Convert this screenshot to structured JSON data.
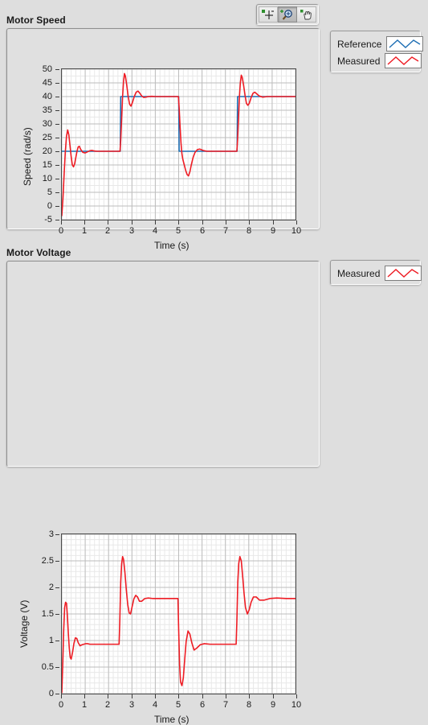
{
  "toolbar": {
    "buttons": [
      {
        "name": "cursor-tool",
        "label": "Cursor movement tool",
        "active": false
      },
      {
        "name": "zoom-tool",
        "label": "Zoom tool",
        "active": true
      },
      {
        "name": "pan-tool",
        "label": "Panning tool",
        "active": false
      }
    ]
  },
  "panels": [
    {
      "title": "Motor Speed",
      "legend": [
        {
          "label": "Reference",
          "color": "#1f6fb4"
        },
        {
          "label": "Measured",
          "color": "#ee1c24"
        }
      ]
    },
    {
      "title": "Motor Voltage",
      "legend": [
        {
          "label": "Measured",
          "color": "#ee1c24"
        }
      ]
    }
  ],
  "chart_data": [
    {
      "type": "line",
      "title": "Motor Speed",
      "xlabel": "Time (s)",
      "ylabel": "Speed (rad/s)",
      "xlim": [
        0,
        10
      ],
      "ylim": [
        -5,
        50
      ],
      "xticks": [
        0,
        1,
        2,
        3,
        4,
        5,
        6,
        7,
        8,
        9,
        10
      ],
      "yticks": [
        -5,
        0,
        5,
        10,
        15,
        20,
        25,
        30,
        35,
        40,
        45,
        50
      ],
      "grid": true,
      "legend_position": "right-outside",
      "series": [
        {
          "name": "Reference",
          "color": "#1f6fb4",
          "x": [
            0,
            0.02,
            2.5,
            2.52,
            5.0,
            5.02,
            7.5,
            7.52,
            10
          ],
          "values": [
            20,
            20,
            20,
            40,
            40,
            20,
            20,
            40,
            40
          ]
        },
        {
          "name": "Measured",
          "color": "#ee1c24",
          "x": [
            0.0,
            0.05,
            0.1,
            0.15,
            0.2,
            0.25,
            0.3,
            0.35,
            0.4,
            0.45,
            0.5,
            0.55,
            0.6,
            0.65,
            0.7,
            0.75,
            0.8,
            0.9,
            1.0,
            1.1,
            1.2,
            1.3,
            1.4,
            1.5,
            1.7,
            2.0,
            2.3,
            2.49,
            2.52,
            2.56,
            2.6,
            2.64,
            2.68,
            2.72,
            2.78,
            2.84,
            2.9,
            2.96,
            3.02,
            3.1,
            3.18,
            3.26,
            3.34,
            3.42,
            3.5,
            3.6,
            3.7,
            3.85,
            4.0,
            4.3,
            4.7,
            4.99,
            5.02,
            5.06,
            5.1,
            5.14,
            5.18,
            5.24,
            5.3,
            5.36,
            5.42,
            5.48,
            5.54,
            5.62,
            5.7,
            5.8,
            5.9,
            6.05,
            6.2,
            6.5,
            7.0,
            7.49,
            7.52,
            7.56,
            7.6,
            7.64,
            7.68,
            7.72,
            7.78,
            7.84,
            7.9,
            7.96,
            8.02,
            8.1,
            8.18,
            8.26,
            8.34,
            8.45,
            8.6,
            8.8,
            9.1,
            9.5,
            10.0
          ],
          "values": [
            -3.5,
            3.0,
            12.0,
            20.0,
            25.5,
            27.8,
            26.0,
            22.0,
            18.0,
            15.0,
            14.3,
            15.5,
            17.8,
            20.0,
            21.6,
            21.8,
            20.8,
            19.6,
            19.4,
            19.8,
            20.2,
            20.3,
            20.1,
            20.0,
            20.0,
            20.0,
            20.0,
            20.0,
            24.0,
            32.0,
            40.0,
            45.5,
            48.4,
            47.5,
            44.0,
            40.0,
            37.2,
            36.5,
            37.8,
            40.0,
            41.6,
            42.0,
            41.2,
            40.2,
            39.7,
            39.8,
            40.0,
            40.1,
            40.0,
            40.0,
            40.0,
            40.0,
            36.0,
            29.0,
            23.0,
            19.0,
            17.0,
            15.0,
            13.0,
            11.5,
            11.0,
            12.5,
            15.0,
            17.8,
            19.6,
            20.6,
            20.8,
            20.3,
            20.0,
            20.0,
            20.0,
            20.0,
            24.0,
            32.0,
            40.0,
            45.0,
            47.8,
            47.0,
            44.0,
            40.5,
            37.5,
            36.8,
            37.5,
            39.6,
            41.2,
            41.6,
            41.0,
            40.2,
            39.8,
            40.0,
            40.0,
            40.0,
            40.0
          ]
        }
      ]
    },
    {
      "type": "line",
      "title": "Motor Voltage",
      "xlabel": "Time (s)",
      "ylabel": "Voltage (V)",
      "xlim": [
        0,
        10
      ],
      "ylim": [
        0,
        3
      ],
      "xticks": [
        0,
        1,
        2,
        3,
        4,
        5,
        6,
        7,
        8,
        9,
        10
      ],
      "yticks": [
        0,
        0.5,
        1,
        1.5,
        2,
        2.5,
        3
      ],
      "grid": true,
      "legend_position": "right-outside",
      "series": [
        {
          "name": "Measured",
          "color": "#ee1c24",
          "x": [
            0.0,
            0.04,
            0.08,
            0.12,
            0.16,
            0.2,
            0.24,
            0.28,
            0.32,
            0.36,
            0.4,
            0.46,
            0.52,
            0.58,
            0.64,
            0.7,
            0.78,
            0.86,
            0.94,
            1.02,
            1.1,
            1.2,
            1.3,
            1.45,
            1.6,
            1.8,
            2.1,
            2.45,
            2.48,
            2.52,
            2.56,
            2.6,
            2.64,
            2.7,
            2.76,
            2.82,
            2.88,
            2.94,
            3.0,
            3.08,
            3.16,
            3.24,
            3.32,
            3.42,
            3.55,
            3.7,
            3.9,
            4.2,
            4.6,
            4.97,
            5.0,
            5.04,
            5.08,
            5.14,
            5.2,
            5.26,
            5.32,
            5.4,
            5.48,
            5.56,
            5.66,
            5.78,
            5.92,
            6.1,
            6.35,
            6.7,
            7.1,
            7.46,
            7.49,
            7.53,
            7.57,
            7.62,
            7.68,
            7.74,
            7.8,
            7.86,
            7.94,
            8.02,
            8.1,
            8.2,
            8.32,
            8.46,
            8.65,
            8.9,
            9.2,
            9.6,
            10.0
          ],
          "values": [
            0.02,
            0.55,
            1.2,
            1.62,
            1.72,
            1.7,
            1.45,
            1.12,
            0.85,
            0.68,
            0.65,
            0.78,
            0.95,
            1.05,
            1.04,
            0.96,
            0.9,
            0.92,
            0.93,
            0.94,
            0.94,
            0.93,
            0.93,
            0.93,
            0.93,
            0.93,
            0.93,
            0.93,
            1.35,
            2.1,
            2.45,
            2.58,
            2.53,
            2.28,
            1.95,
            1.68,
            1.52,
            1.5,
            1.62,
            1.78,
            1.85,
            1.82,
            1.74,
            1.74,
            1.79,
            1.8,
            1.79,
            1.79,
            1.79,
            1.79,
            1.2,
            0.55,
            0.22,
            0.15,
            0.3,
            0.65,
            0.98,
            1.18,
            1.12,
            0.96,
            0.82,
            0.86,
            0.92,
            0.94,
            0.93,
            0.93,
            0.93,
            0.93,
            1.35,
            2.1,
            2.45,
            2.58,
            2.5,
            2.2,
            1.88,
            1.62,
            1.5,
            1.58,
            1.72,
            1.82,
            1.82,
            1.76,
            1.76,
            1.79,
            1.8,
            1.79,
            1.79
          ]
        }
      ]
    }
  ]
}
